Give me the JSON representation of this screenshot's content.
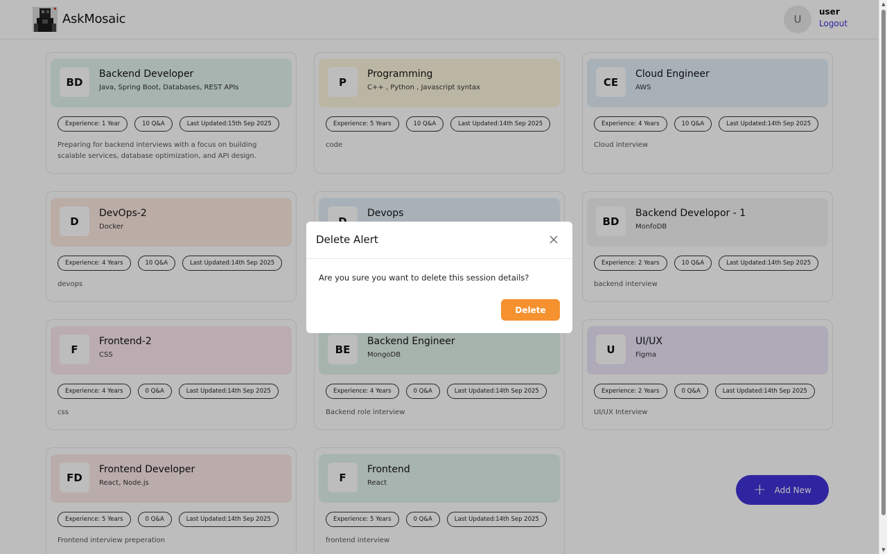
{
  "header": {
    "brand": "AskMosaic",
    "avatar_initial": "U",
    "user_name": "user",
    "logout_label": "Logout"
  },
  "cards": [
    {
      "initials": "BD",
      "role": "Backend Developer",
      "topics": "Java, Spring Boot, Databases, REST APIs",
      "experience": "Experience: 1 Year",
      "qa": "10 Q&A",
      "updated": "Last Updated:15th Sep 2025",
      "description": "Preparing for backend interviews with a focus on building scalable services, database optimization, and API design.",
      "color": "#e2f3ee"
    },
    {
      "initials": "P",
      "role": "Programming",
      "topics": "C++ , Python , Javascript syntax",
      "experience": "Experience: 5 Years",
      "qa": "10 Q&A",
      "updated": "Last Updated:14th Sep 2025",
      "description": "code",
      "color": "#fdf6dc"
    },
    {
      "initials": "CE",
      "role": "Cloud Engineer",
      "topics": "AWS",
      "experience": "Experience: 4 Years",
      "qa": "10 Q&A",
      "updated": "Last Updated:14th Sep 2025",
      "description": "Cloud interview",
      "color": "#e3eff8"
    },
    {
      "initials": "D",
      "role": "DevOps-2",
      "topics": "Docker",
      "experience": "Experience: 4 Years",
      "qa": "10 Q&A",
      "updated": "Last Updated:14th Sep 2025",
      "description": "devops",
      "color": "#fde9e1"
    },
    {
      "initials": "D",
      "role": "Devops",
      "topics": "",
      "experience": "",
      "qa": "",
      "updated": "",
      "description": "",
      "color": "#e3eff8"
    },
    {
      "initials": "BD",
      "role": "Backend Developor - 1",
      "topics": "MonfoDB",
      "experience": "Experience: 2 Years",
      "qa": "10 Q&A",
      "updated": "Last Updated:14th Sep 2025",
      "description": "backend interview",
      "color": "#f3f3f3"
    },
    {
      "initials": "F",
      "role": "Frontend-2",
      "topics": "CSS",
      "experience": "Experience: 4 Years",
      "qa": "0 Q&A",
      "updated": "Last Updated:14th Sep 2025",
      "description": "css",
      "color": "#fbe9ee"
    },
    {
      "initials": "BE",
      "role": "Backend Engineer",
      "topics": "MongoDB",
      "experience": "Experience: 4 Years",
      "qa": "0 Q&A",
      "updated": "Last Updated:14th Sep 2025",
      "description": "Backend role interview",
      "color": "#e2f3ea"
    },
    {
      "initials": "U",
      "role": "UI/UX",
      "topics": "Figma",
      "experience": "Experience: 2 Years",
      "qa": "0 Q&A",
      "updated": "Last Updated:14th Sep 2025",
      "description": "UI/UX Interview",
      "color": "#ebe6f9"
    },
    {
      "initials": "FD",
      "role": "Frontend Developer",
      "topics": "React, Node.js",
      "experience": "Experience: 5 Years",
      "qa": "0 Q&A",
      "updated": "Last Updated:14th Sep 2025",
      "description": "Frontend interview preperation",
      "color": "#fde8e8"
    },
    {
      "initials": "F",
      "role": "Frontend",
      "topics": "React",
      "experience": "Experience: 5 Years",
      "qa": "0 Q&A",
      "updated": "Last Updated:14th Sep 2025",
      "description": "frontend interview",
      "color": "#e2f3ee"
    }
  ],
  "add_new": {
    "label": "Add New",
    "color": "#4133d8"
  },
  "modal": {
    "title": "Delete Alert",
    "message": "Are you sure you want to delete this session details?",
    "delete_label": "Delete",
    "delete_color": "#f5912e"
  }
}
